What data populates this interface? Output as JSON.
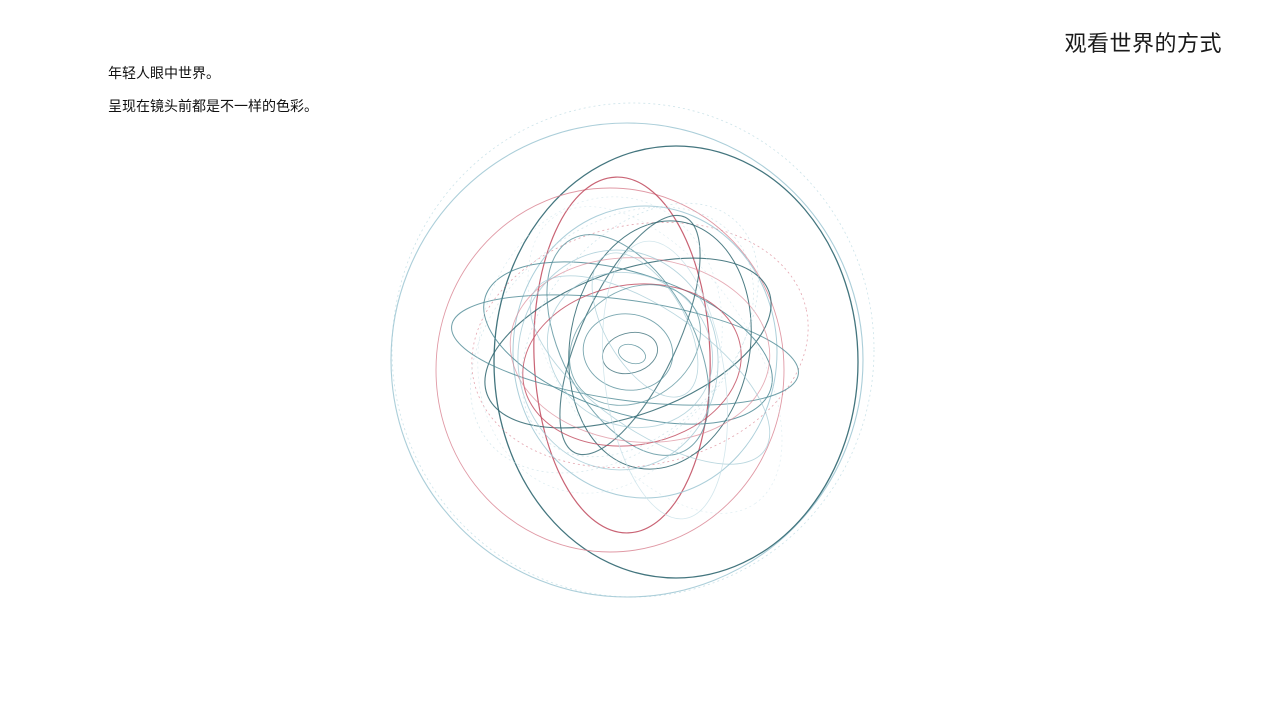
{
  "page": {
    "title": "观看世界的方式"
  },
  "intro": {
    "lines": [
      "年轻人眼中世界。",
      "呈现在镜头前都是不一样的色彩。"
    ]
  },
  "artwork": {
    "description_free": true,
    "colors": {
      "dark_teal": "#2f6670",
      "teal": "#4d8a95",
      "light_blue": "#9cc6d2",
      "pale_blue": "#c7e0e7",
      "crimson": "#c0485c",
      "rose": "#d8808f"
    }
  }
}
